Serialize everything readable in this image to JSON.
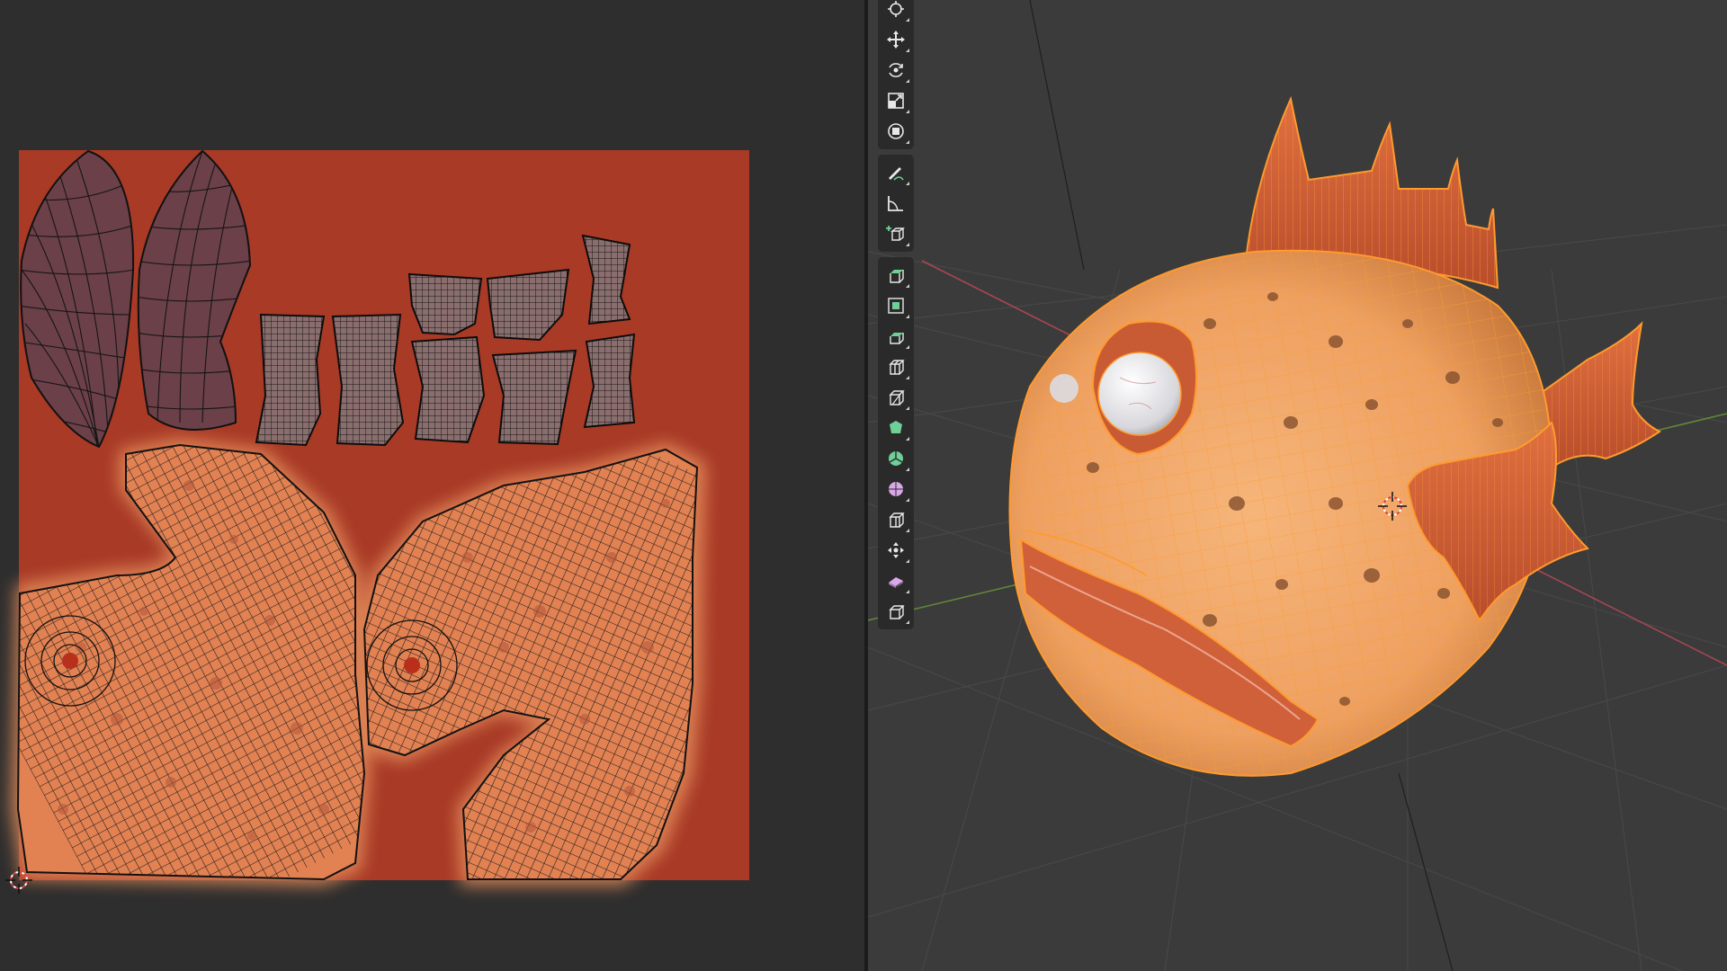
{
  "editor": {
    "left_area": "uv-editor",
    "right_area": "3d-viewport",
    "mode": "edit"
  },
  "colors": {
    "uv_background": "#a83a26",
    "uv_island_body": "#e07e4f",
    "uv_island_fin": "#6b4049",
    "mesh_wire": "#ff9a2e",
    "fish_body": "#f0a462",
    "viewport_bg": "#3b3b3b",
    "uv_editor_bg": "#2e2e2e",
    "axis_x": "#c04a5a",
    "axis_y": "#6a9a3a"
  },
  "toolbar": {
    "tools": [
      {
        "icon": "select-cursor-icon",
        "active": false
      },
      {
        "icon": "move-icon",
        "active": false
      },
      {
        "icon": "rotate-icon",
        "active": false
      },
      {
        "icon": "scale-icon",
        "active": false
      },
      {
        "icon": "transform-icon",
        "active": false
      },
      {
        "icon": "annotate-icon",
        "active": false
      },
      {
        "icon": "measure-icon",
        "active": false
      },
      {
        "icon": "add-cube-icon",
        "active": false
      },
      {
        "icon": "extrude-region-icon",
        "active": false
      },
      {
        "icon": "inset-faces-icon",
        "active": false
      },
      {
        "icon": "bevel-icon",
        "active": false
      },
      {
        "icon": "loop-cut-icon",
        "active": false
      },
      {
        "icon": "knife-icon",
        "active": false
      },
      {
        "icon": "poly-build-icon",
        "active": false
      },
      {
        "icon": "spin-icon",
        "active": false
      },
      {
        "icon": "smooth-icon",
        "active": false
      },
      {
        "icon": "edge-slide-icon",
        "active": false
      },
      {
        "icon": "shrink-fatten-icon",
        "active": false
      },
      {
        "icon": "shear-icon",
        "active": false
      },
      {
        "icon": "rip-region-icon",
        "active": false
      }
    ]
  }
}
